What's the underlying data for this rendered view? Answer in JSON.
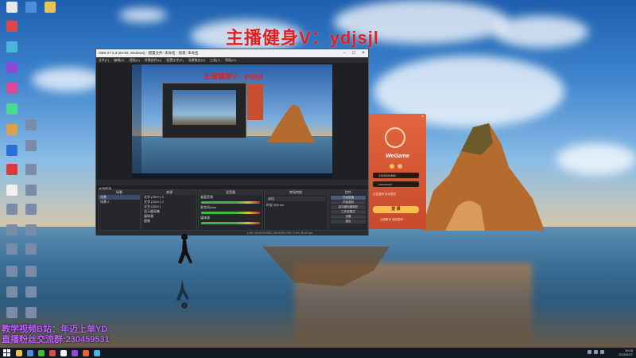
{
  "watermarks": {
    "top": "主播健身V：ydjsjl",
    "bottom_line1": "教学视频B站：年迈上单YD",
    "bottom_line2": "直播粉丝交流群:230459531",
    "preview": "主播健身V：ydjsjl"
  },
  "desktop_icons": [
    {
      "label": "",
      "color": "#e8e8e8"
    },
    {
      "label": "",
      "color": "#4b8fd9"
    },
    {
      "label": "",
      "color": "#e9c25a"
    },
    {
      "label": "",
      "color": "#d94b4b"
    },
    {
      "label": "",
      "color": "#4bb5d9"
    },
    {
      "label": "",
      "color": "#8a4bd9"
    },
    {
      "label": "",
      "color": "#d94b9a"
    },
    {
      "label": "",
      "color": "#4bd98a"
    },
    {
      "label": "",
      "color": "#d9a24b"
    },
    {
      "label": "",
      "color": "#2b6fd9"
    },
    {
      "label": "",
      "color": "#d93b3b"
    },
    {
      "label": "",
      "color": "#f0f0f0"
    }
  ],
  "obs": {
    "title": "OBS 27.2.3 (64-bit, windows) - 配置文件: 未命名 - 场景: 未命名",
    "menu": [
      "文件(F)",
      "编辑(E)",
      "视图(V)",
      "停靠部件(D)",
      "配置文件(P)",
      "场景集合(S)",
      "工具(T)",
      "帮助(H)"
    ],
    "dock_title": "来源图源",
    "docks": {
      "scenes": {
        "header": "场景",
        "items": [
          "场景",
          "场景 2"
        ]
      },
      "sources": {
        "header": "来源",
        "items": [
          "文字 (GDI+) 3",
          "文字 (GDI+) 2",
          "文字 (GDI+)",
          "显示器采集",
          "媒体源",
          "图像"
        ]
      },
      "mixer": {
        "header": "混音器",
        "items": [
          "桌面音频",
          "麦克风/Aux",
          "媒体源"
        ]
      },
      "transitions": {
        "header": "转场特效",
        "fade": "淡出",
        "duration_label": "时长",
        "duration": "300 ms"
      },
      "controls": {
        "header": "控件",
        "buttons": [
          "开始直播",
          "开始录制",
          "启动虚拟摄像机",
          "工作室模式",
          "设置",
          "退出"
        ]
      }
    },
    "status": "LIVE: 00:00:00   REC: 00:00:00   CPU: 1.2%, 30.00 fps"
  },
  "wegame": {
    "logo_text": "WeGame",
    "account": "1325344862",
    "password": "••••••••••••",
    "option": "记住密码  自动登录",
    "login_button": "登 录",
    "links": "注册账号  找回密码"
  },
  "taskbar": {
    "time": "19:18",
    "date": "2022/6/27",
    "apps": [
      "#e9c25a",
      "#4b8fd9",
      "#3dbb3d",
      "#d94b4b",
      "#f0f0f0",
      "#8a4bd9",
      "#e2653e",
      "#4bb5d9"
    ]
  }
}
